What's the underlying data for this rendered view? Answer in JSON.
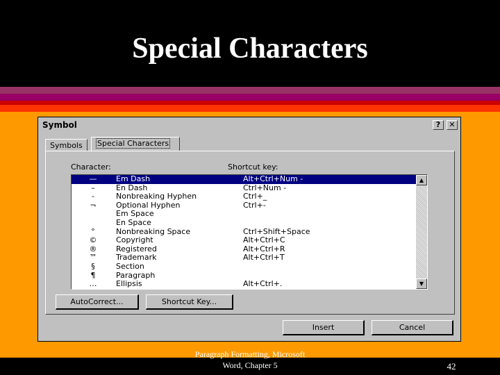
{
  "slide": {
    "title": "Special Characters",
    "footer_line1": "Paragraph Formatting, Microsoft",
    "footer_line2": "Word, Chapter 5",
    "page_number": "42"
  },
  "dialog": {
    "title": "Symbol",
    "help_label": "?",
    "close_label": "✕",
    "tabs": [
      {
        "label": "Symbols",
        "active": false
      },
      {
        "label": "Special Characters",
        "active": true
      }
    ],
    "character_header": "Character:",
    "shortcut_header": "Shortcut key:",
    "rows": [
      {
        "symbol": "—",
        "name": "Em Dash",
        "shortcut": "Alt+Ctrl+Num -",
        "selected": true
      },
      {
        "symbol": "–",
        "name": "En Dash",
        "shortcut": "Ctrl+Num -"
      },
      {
        "symbol": "-",
        "name": "Nonbreaking Hyphen",
        "shortcut": "Ctrl+_"
      },
      {
        "symbol": "¬",
        "name": "Optional Hyphen",
        "shortcut": "Ctrl+-"
      },
      {
        "symbol": "",
        "name": "Em Space",
        "shortcut": ""
      },
      {
        "symbol": "",
        "name": "En Space",
        "shortcut": ""
      },
      {
        "symbol": "°",
        "name": "Nonbreaking Space",
        "shortcut": "Ctrl+Shift+Space"
      },
      {
        "symbol": "©",
        "name": "Copyright",
        "shortcut": "Alt+Ctrl+C"
      },
      {
        "symbol": "®",
        "name": "Registered",
        "shortcut": "Alt+Ctrl+R"
      },
      {
        "symbol": "™",
        "name": "Trademark",
        "shortcut": "Alt+Ctrl+T"
      },
      {
        "symbol": "§",
        "name": "Section",
        "shortcut": ""
      },
      {
        "symbol": "¶",
        "name": "Paragraph",
        "shortcut": ""
      },
      {
        "symbol": "…",
        "name": "Ellipsis",
        "shortcut": "Alt+Ctrl+."
      }
    ],
    "autocorrect_label": "AutoCorrect...",
    "shortcut_key_label": "Shortcut Key...",
    "insert_label": "Insert",
    "cancel_label": "Cancel"
  },
  "colors": {
    "background": "#ff9900",
    "header": "#000000",
    "selection": "#000080"
  }
}
